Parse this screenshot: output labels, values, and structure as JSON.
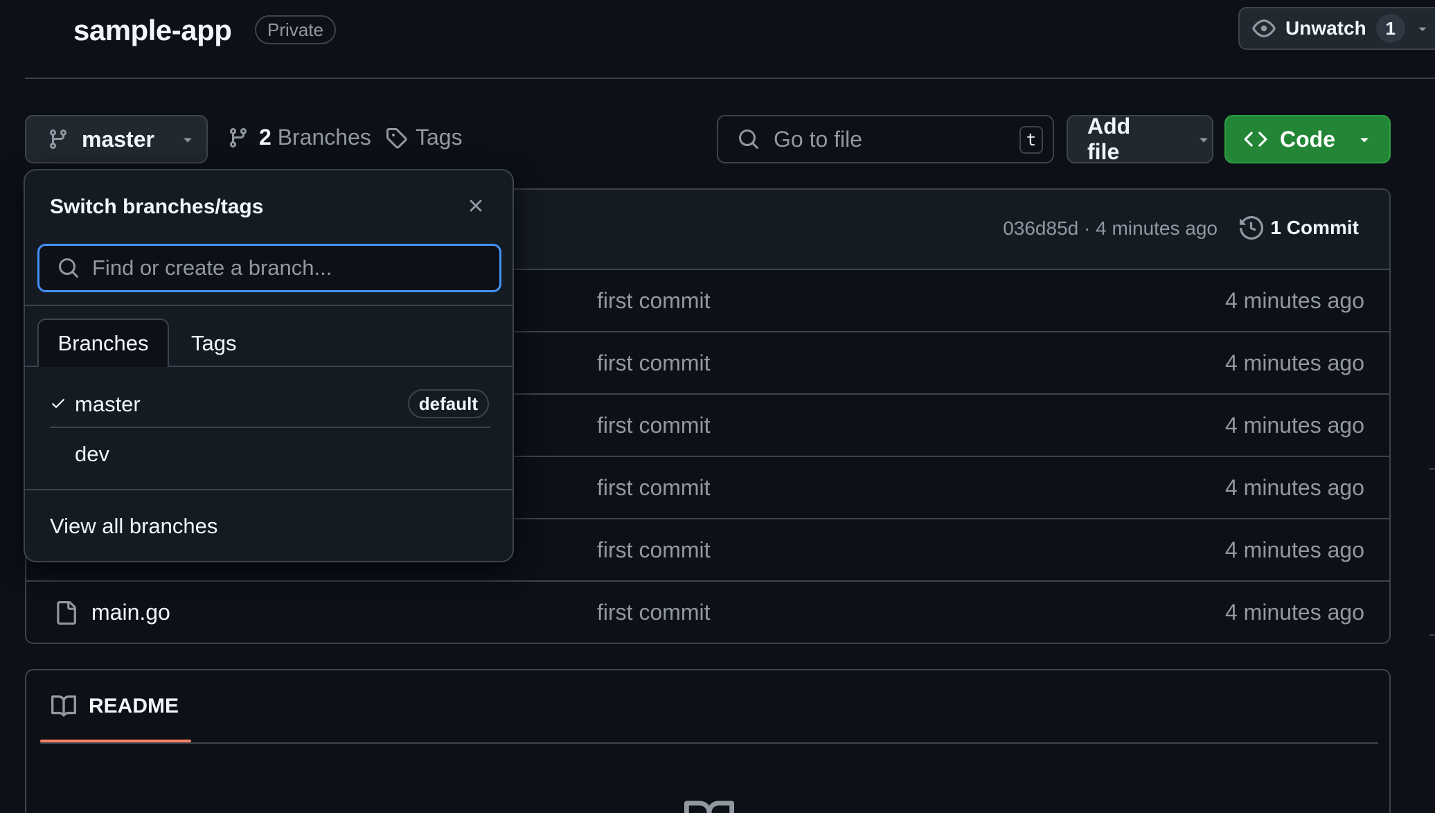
{
  "repo": {
    "name": "sample-app",
    "visibility": "Private"
  },
  "watch": {
    "label": "Unwatch",
    "count": "1"
  },
  "toolbar": {
    "branch": "master",
    "branch_count": "2",
    "branches_label": "Branches",
    "tags_label": "Tags",
    "goto_placeholder": "Go to file",
    "goto_shortcut": "t",
    "add_file_label": "Add file",
    "code_label": "Code"
  },
  "latest_commit": {
    "meta": "036d85d · 4 minutes ago",
    "count_label": "1 Commit"
  },
  "files": [
    {
      "name": "",
      "message": "first commit",
      "time": "4 minutes ago"
    },
    {
      "name": "",
      "message": "first commit",
      "time": "4 minutes ago"
    },
    {
      "name": "",
      "message": "first commit",
      "time": "4 minutes ago"
    },
    {
      "name": "",
      "message": "first commit",
      "time": "4 minutes ago"
    },
    {
      "name": "",
      "message": "first commit",
      "time": "4 minutes ago"
    },
    {
      "name": "main.go",
      "message": "first commit",
      "time": "4 minutes ago"
    }
  ],
  "readme": {
    "tab_label": "README"
  },
  "dropdown": {
    "title": "Switch branches/tags",
    "search_placeholder": "Find or create a branch...",
    "tabs": [
      "Branches",
      "Tags"
    ],
    "branches": [
      {
        "name": "master",
        "badge": "default",
        "selected": true
      },
      {
        "name": "dev",
        "badge": "",
        "selected": false
      }
    ],
    "footer_link": "View all branches"
  },
  "colors": {
    "background": "#0d1117",
    "border": "#3d444d",
    "primary_button": "#238636",
    "focus_ring": "#4493f8",
    "readme_underline": "#f78166"
  }
}
